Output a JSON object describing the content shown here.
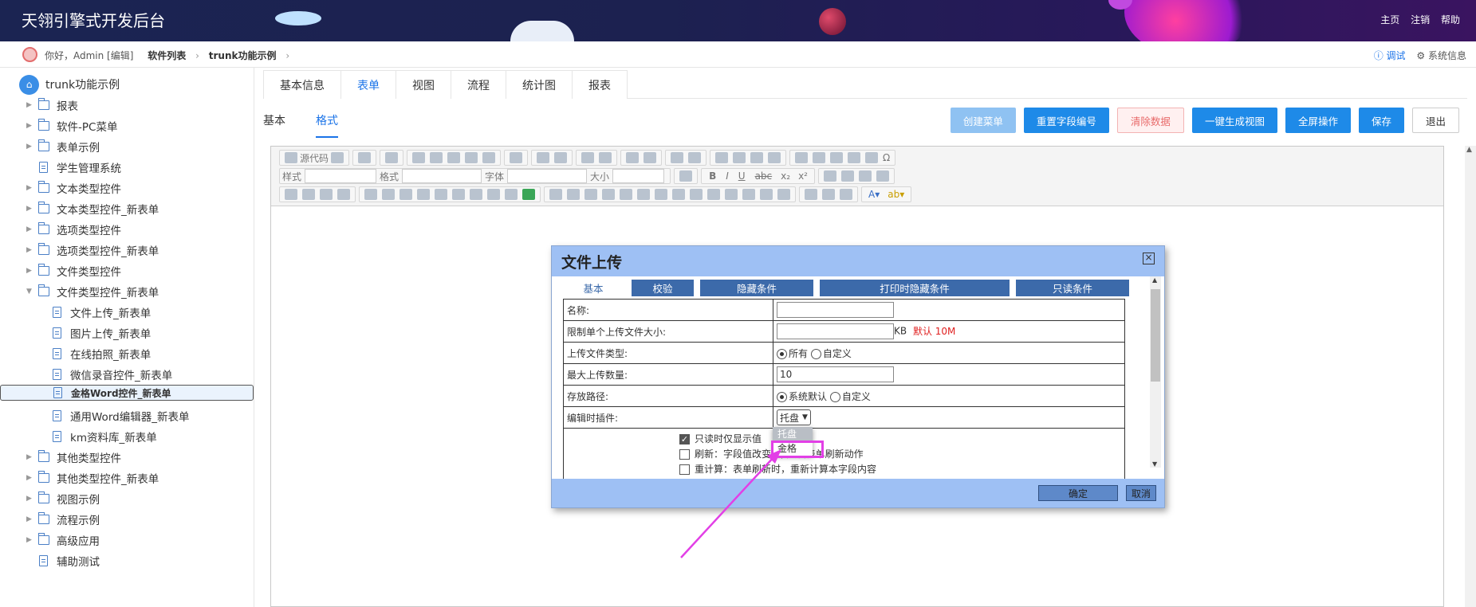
{
  "header": {
    "app_title": "天翎引擎式开发后台",
    "links": [
      "主页",
      "注销",
      "帮助"
    ]
  },
  "userbar": {
    "greeting": "你好，Admin [编辑]",
    "breadcrumb": [
      "软件列表",
      "trunk功能示例"
    ],
    "right_debug": "调试",
    "right_sysinfo": "系统信息"
  },
  "sidebar": {
    "root": "trunk功能示例",
    "items": [
      {
        "label": "报表",
        "type": "folder",
        "level": 0,
        "arrow": "▶"
      },
      {
        "label": "软件-PC菜单",
        "type": "folder",
        "level": 0,
        "arrow": "▶"
      },
      {
        "label": "表单示例",
        "type": "folder",
        "level": 0,
        "arrow": "▶"
      },
      {
        "label": "学生管理系统",
        "type": "doc",
        "level": 0,
        "arrow": ""
      },
      {
        "label": "文本类型控件",
        "type": "folder",
        "level": 0,
        "arrow": "▶"
      },
      {
        "label": "文本类型控件_新表单",
        "type": "folder",
        "level": 0,
        "arrow": "▶"
      },
      {
        "label": "选项类型控件",
        "type": "folder",
        "level": 0,
        "arrow": "▶"
      },
      {
        "label": "选项类型控件_新表单",
        "type": "folder",
        "level": 0,
        "arrow": "▶"
      },
      {
        "label": "文件类型控件",
        "type": "folder",
        "level": 0,
        "arrow": "▶"
      },
      {
        "label": "文件类型控件_新表单",
        "type": "folder",
        "level": 0,
        "arrow": "▼"
      },
      {
        "label": "文件上传_新表单",
        "type": "doc",
        "level": 1,
        "arrow": ""
      },
      {
        "label": "图片上传_新表单",
        "type": "doc",
        "level": 1,
        "arrow": ""
      },
      {
        "label": "在线拍照_新表单",
        "type": "doc",
        "level": 1,
        "arrow": ""
      },
      {
        "label": "微信录音控件_新表单",
        "type": "doc",
        "level": 1,
        "arrow": ""
      },
      {
        "label": "金格Word控件_新表单",
        "type": "doc",
        "level": 1,
        "arrow": "",
        "selected": true
      },
      {
        "label": "通用Word编辑器_新表单",
        "type": "doc",
        "level": 1,
        "arrow": ""
      },
      {
        "label": "km资料库_新表单",
        "type": "doc",
        "level": 1,
        "arrow": ""
      },
      {
        "label": "其他类型控件",
        "type": "folder",
        "level": 0,
        "arrow": "▶"
      },
      {
        "label": "其他类型控件_新表单",
        "type": "folder",
        "level": 0,
        "arrow": "▶"
      },
      {
        "label": "视图示例",
        "type": "folder",
        "level": 0,
        "arrow": "▶"
      },
      {
        "label": "流程示例",
        "type": "folder",
        "level": 0,
        "arrow": "▶"
      },
      {
        "label": "高级应用",
        "type": "folder",
        "level": 0,
        "arrow": "▶"
      },
      {
        "label": "辅助测试",
        "type": "doc",
        "level": 0,
        "arrow": ""
      }
    ]
  },
  "tabs": [
    "基本信息",
    "表单",
    "视图",
    "流程",
    "统计图",
    "报表"
  ],
  "active_tab": 1,
  "subtabs": [
    "基本",
    "格式"
  ],
  "active_subtab": 1,
  "actions": [
    {
      "label": "创建菜单",
      "style": "light"
    },
    {
      "label": "重置字段编号",
      "style": "primary"
    },
    {
      "label": "清除数据",
      "style": "danger"
    },
    {
      "label": "一键生成视图",
      "style": "primary"
    },
    {
      "label": "全屏操作",
      "style": "primary"
    },
    {
      "label": "保存",
      "style": "primary"
    },
    {
      "label": "退出",
      "style": "plain"
    }
  ],
  "toolbar": {
    "source_label": "源代码",
    "style_label": "样式",
    "format_label": "格式",
    "font_label": "字体",
    "size_label": "大小"
  },
  "dialog": {
    "title": "文件上传",
    "tabs": [
      "基本",
      "校验",
      "隐藏条件",
      "打印时隐藏条件",
      "只读条件"
    ],
    "rows": {
      "name_label": "名称:",
      "name_value": "",
      "maxsize_label": "限制单个上传文件大小:",
      "maxsize_value": "",
      "maxsize_unit": "KB",
      "maxsize_default": "默认 10M",
      "type_label": "上传文件类型:",
      "type_opt1": "所有",
      "type_opt2": "自定义",
      "count_label": "最大上传数量:",
      "count_value": "10",
      "path_label": "存放路径:",
      "path_opt1": "系统默认",
      "path_opt2": "自定义",
      "plugin_label": "编辑时插件:",
      "plugin_value": "托盘"
    },
    "checks": [
      {
        "label": "只读时仅显示值",
        "checked": true
      },
      {
        "label": "刷新：字段值改变时, 触发表单刷新动作",
        "checked": false
      },
      {
        "label": "重计算：表单刷新时，重新计算本字段内容",
        "checked": false
      }
    ],
    "ok": "确定",
    "cancel": "取消"
  },
  "dropdown": {
    "options": [
      "托盘",
      "金格"
    ],
    "highlighted": 0
  },
  "colors": {
    "accent": "#1e8ae8",
    "dialog_header": "#9ec0f4",
    "annotation": "#e23fe6"
  }
}
